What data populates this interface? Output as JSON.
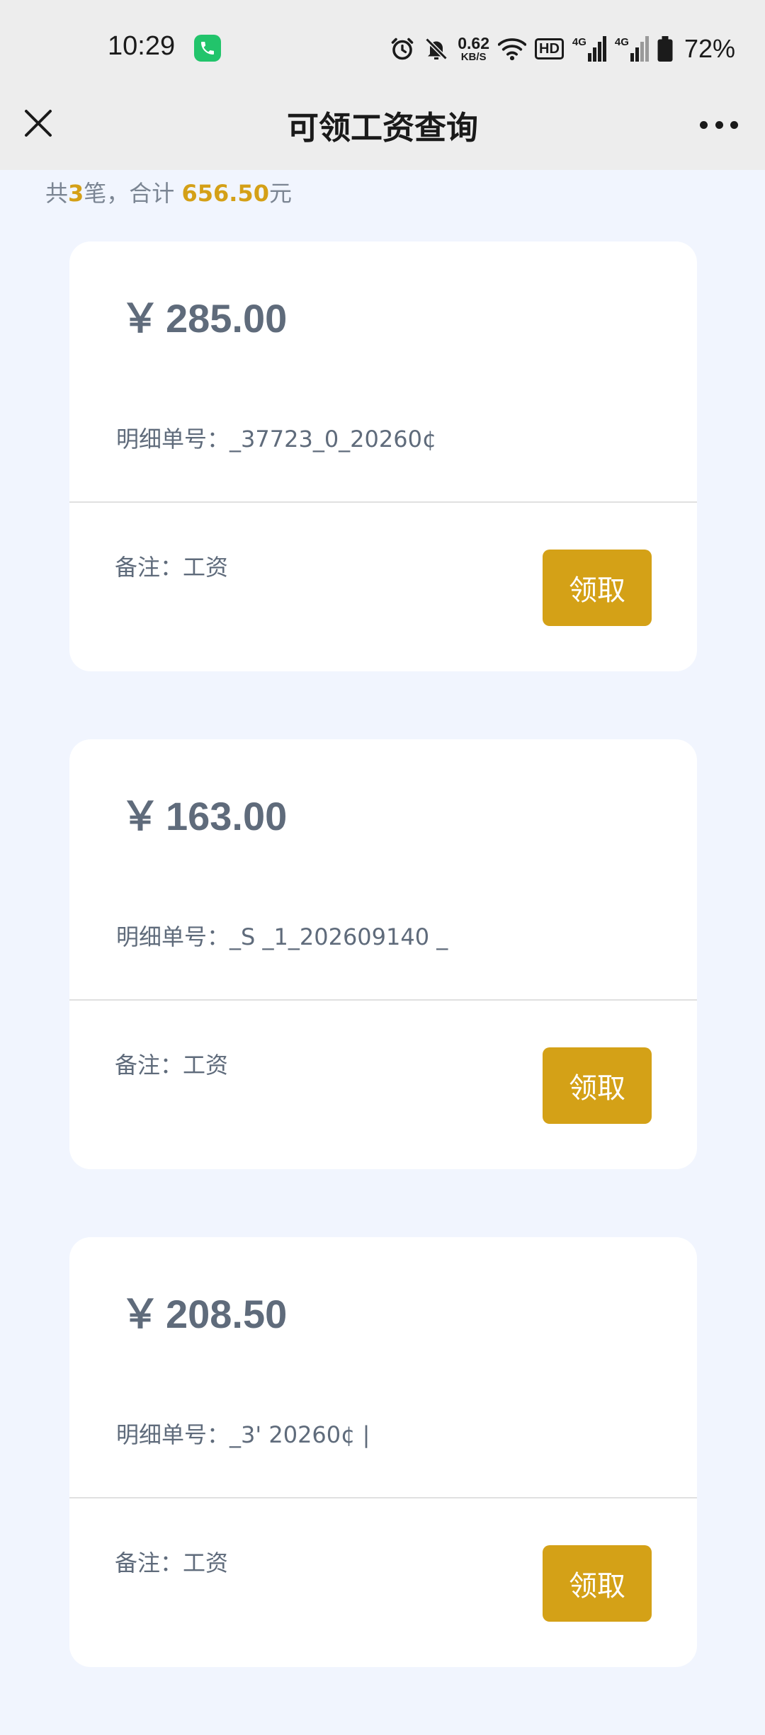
{
  "status_bar": {
    "time": "10:29",
    "net_speed_value": "0.62",
    "net_speed_unit": "KB/S",
    "hd_label": "HD",
    "sim1_label": "4G",
    "sim2_label": "4G",
    "battery_percent": "72%",
    "icons": [
      "call-icon",
      "alarm-icon",
      "mute-bell-icon",
      "wifi-icon",
      "hd-icon",
      "signal-icon",
      "battery-icon"
    ],
    "call_color": "#22c46b"
  },
  "nav": {
    "title": "可领工资查询",
    "close_icon": "close-icon",
    "more_icon": "more-dots-icon"
  },
  "summary": {
    "prefix": "共",
    "count": "3",
    "middle": "笔，合计 ",
    "total": "656.50",
    "suffix": "元"
  },
  "cards": [
    {
      "currency": "￥",
      "amount": "285.00",
      "detail_label": "明细单号：",
      "detail_value": "_37723_0_20260¢",
      "remark": "备注：工资",
      "button_label": "领取"
    },
    {
      "currency": "￥",
      "amount": "163.00",
      "detail_label": "明细单号：",
      "detail_value": "_S   _1_202609140        _",
      "remark": "备注：工资",
      "button_label": "领取"
    },
    {
      "currency": "￥",
      "amount": "208.50",
      "detail_label": "明细单号：",
      "detail_value": "_3'        20260¢    |",
      "remark": "备注：工资",
      "button_label": "领取"
    }
  ],
  "colors": {
    "page_bg": "#f1f5fe",
    "accent": "#d4a117",
    "text_muted": "#5f6b7b",
    "header_bg": "#ededed"
  }
}
